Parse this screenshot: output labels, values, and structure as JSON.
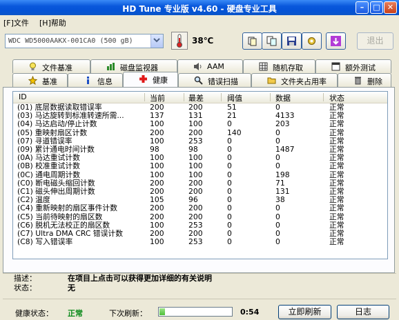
{
  "window": {
    "title": "HD Tune 专业版 v4.60 - 硬盘专业工具"
  },
  "menu": {
    "file": "[F]文件",
    "help": "[H]帮助"
  },
  "toolbar": {
    "drive": "WDC WD5000AAKX-001CA0 (500 gB)",
    "temperature": "38℃",
    "exit_label": "退出"
  },
  "tabs_top": [
    "文件基准",
    "磁盘监视器",
    "AAM",
    "随机存取",
    "额外测试"
  ],
  "tabs_bottom": [
    "基准",
    "信息",
    "健康",
    "错误扫描",
    "文件夹占用率",
    "删除"
  ],
  "table": {
    "headers": [
      "ID",
      "当前",
      "最差",
      "阈值",
      "数据",
      "状态"
    ],
    "rows": [
      [
        "(01) 底层数据读取错误率",
        "200",
        "200",
        "51",
        "0",
        "正常"
      ],
      [
        "(03) 马达旋转到标准转速所需...",
        "137",
        "131",
        "21",
        "4133",
        "正常"
      ],
      [
        "(04) 马达启动/停止计数",
        "100",
        "100",
        "0",
        "203",
        "正常"
      ],
      [
        "(05) 重映射扇区计数",
        "200",
        "200",
        "140",
        "0",
        "正常"
      ],
      [
        "(07) 寻道错误率",
        "100",
        "253",
        "0",
        "0",
        "正常"
      ],
      [
        "(09) 累计通电时间计数",
        "98",
        "98",
        "0",
        "1487",
        "正常"
      ],
      [
        "(0A) 马达重试计数",
        "100",
        "100",
        "0",
        "0",
        "正常"
      ],
      [
        "(0B) 校准重试计数",
        "100",
        "100",
        "0",
        "0",
        "正常"
      ],
      [
        "(0C) 通电周期计数",
        "100",
        "100",
        "0",
        "198",
        "正常"
      ],
      [
        "(C0) 断电磁头缩回计数",
        "200",
        "200",
        "0",
        "71",
        "正常"
      ],
      [
        "(C1) 磁头伸出周期计数",
        "200",
        "200",
        "0",
        "131",
        "正常"
      ],
      [
        "(C2) 温度",
        "105",
        "96",
        "0",
        "38",
        "正常"
      ],
      [
        "(C4) 重新映射的扇区事件计数",
        "200",
        "200",
        "0",
        "0",
        "正常"
      ],
      [
        "(C5) 当前待映射的扇区数",
        "200",
        "200",
        "0",
        "0",
        "正常"
      ],
      [
        "(C6) 脱机无法校正的扇区数",
        "100",
        "253",
        "0",
        "0",
        "正常"
      ],
      [
        "(C7) Ultra DMA CRC 错误计数",
        "200",
        "200",
        "0",
        "0",
        "正常"
      ],
      [
        "(C8) 写入错误率",
        "100",
        "253",
        "0",
        "0",
        "正常"
      ]
    ]
  },
  "description": {
    "label": "描述：",
    "text": "在项目上点击可以获得更加详细的有关说明"
  },
  "status": {
    "label": "状态：",
    "text": "无"
  },
  "footer": {
    "health_label": "健康状态：",
    "health_value": "正常",
    "next_refresh_label": "下次刷新：",
    "countdown": "0:54",
    "refresh_progress": 0.08,
    "refresh_button": "立即刷新",
    "log_button": "日志"
  },
  "colors": {
    "titlebar": "#0453d6",
    "ok_green": "#0a8a1a",
    "panel_bg": "#ECE9D8"
  }
}
